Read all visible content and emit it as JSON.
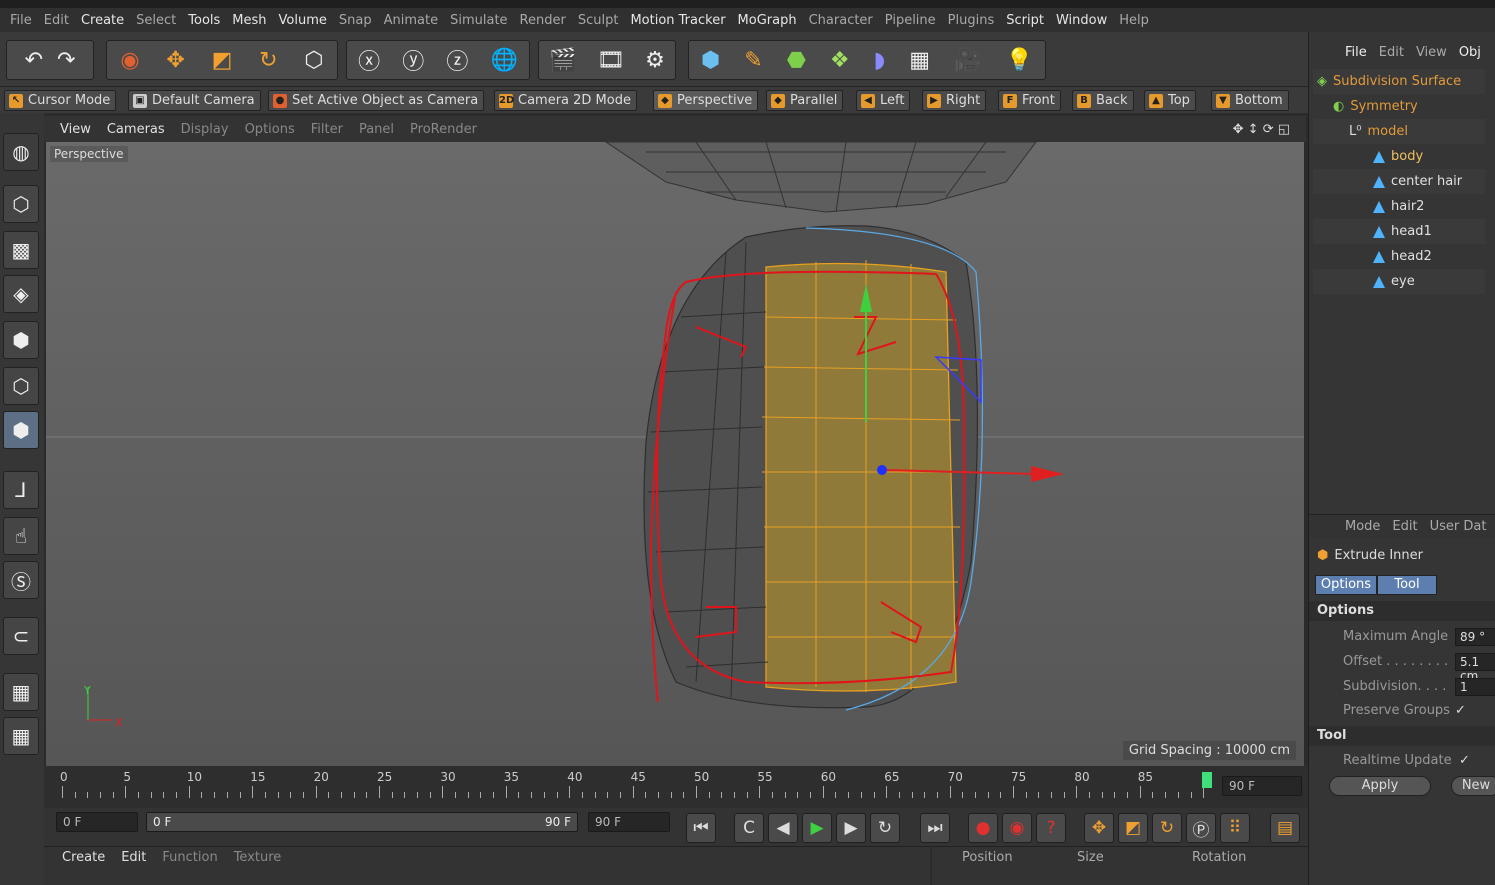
{
  "menu": [
    "File",
    "Edit",
    "Create",
    "Select",
    "Tools",
    "Mesh",
    "Volume",
    "Snap",
    "Animate",
    "Simulate",
    "Render",
    "Sculpt",
    "Motion Tracker",
    "MoGraph",
    "Character",
    "Pipeline",
    "Plugins",
    "Script",
    "Window",
    "Help"
  ],
  "camera_bar": {
    "cursor_mode": "Cursor Mode",
    "default_camera": "Default Camera",
    "set_active": "Set Active Object as Camera",
    "camera_2d": "Camera 2D Mode",
    "perspective": "Perspective",
    "parallel": "Parallel",
    "left": "Left",
    "right": "Right",
    "front": "Front",
    "back": "Back",
    "top": "Top",
    "bottom": "Bottom"
  },
  "viewport_menu": [
    "View",
    "Cameras",
    "Display",
    "Options",
    "Filter",
    "Panel",
    "ProRender"
  ],
  "viewport": {
    "label": "Perspective",
    "grid_spacing": "Grid Spacing : 10000 cm",
    "axis_y": "Y",
    "axis_x": "X"
  },
  "timeline": {
    "ticks": [
      "0",
      "5",
      "10",
      "15",
      "20",
      "25",
      "30",
      "35",
      "40",
      "45",
      "50",
      "55",
      "60",
      "65",
      "70",
      "75",
      "80",
      "85"
    ],
    "end_frame": "90 F"
  },
  "controls": {
    "start": "0 F",
    "range_start": "0 F",
    "range_end": "90 F",
    "end": "90 F"
  },
  "bottom_menu": [
    "Create",
    "Edit",
    "Function",
    "Texture"
  ],
  "coords": {
    "position": "Position",
    "size": "Size",
    "rotation": "Rotation"
  },
  "object_manager": {
    "menu": [
      "File",
      "Edit",
      "View",
      "Obj"
    ],
    "objects": [
      {
        "name": "Subdivision Surface"
      },
      {
        "name": "Symmetry"
      },
      {
        "name": "model"
      },
      {
        "name": "body"
      },
      {
        "name": "center hair"
      },
      {
        "name": "hair2"
      },
      {
        "name": "head1"
      },
      {
        "name": "head2"
      },
      {
        "name": "eye"
      }
    ]
  },
  "attributes": {
    "menu": [
      "Mode",
      "Edit",
      "User Dat"
    ],
    "tool_name": "Extrude Inner",
    "tabs": [
      "Options",
      "Tool"
    ],
    "options_header": "Options",
    "max_angle_label": "Maximum Angle",
    "max_angle": "89 °",
    "offset_label": "Offset . . . . . . . .",
    "offset": "5.1 cm",
    "subdivision_label": "Subdivision. . . .",
    "subdivision": "1",
    "preserve_label": "Preserve Groups",
    "tool_header": "Tool",
    "realtime_label": "Realtime Update",
    "apply": "Apply",
    "new": "New"
  }
}
